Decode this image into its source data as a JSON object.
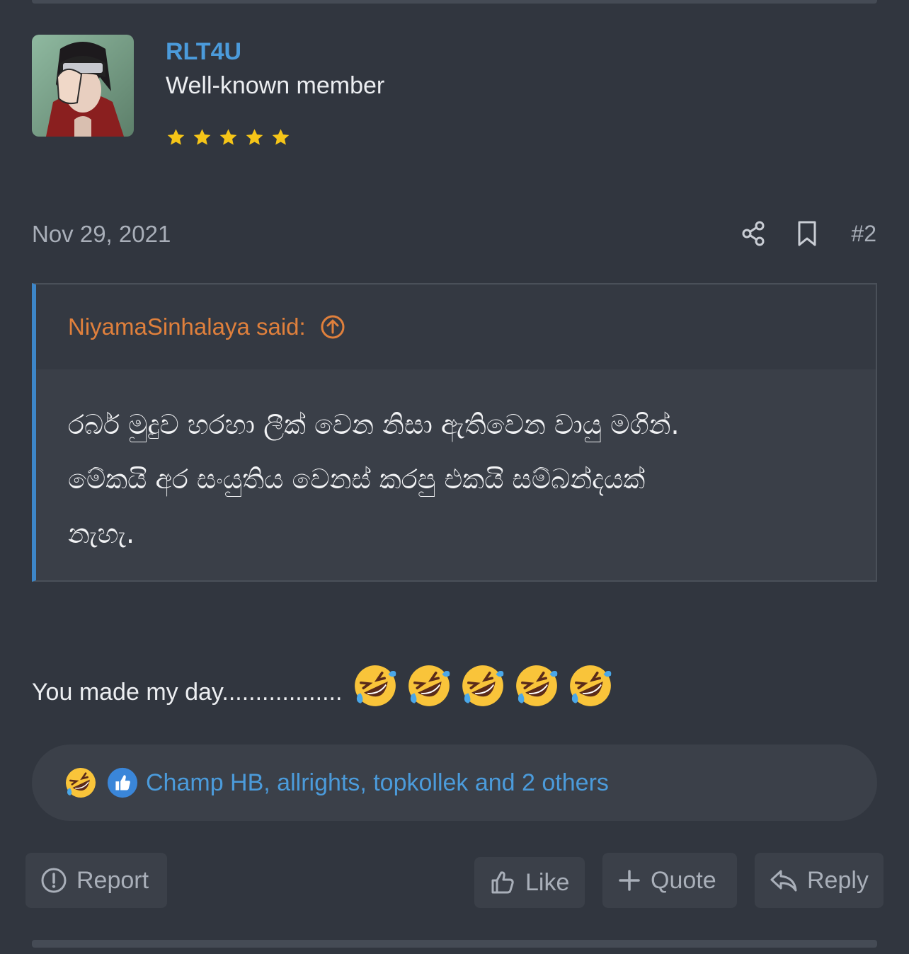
{
  "post": {
    "author": {
      "username": "RLT4U",
      "title": "Well-known member",
      "stars": 5
    },
    "date": "Nov 29, 2021",
    "number": "#2",
    "quote": {
      "author_label": "NiyamaSinhalaya said:",
      "lines": [
        "රබර් මුදුව හරහා ලීක් වෙන නිසා ඇතිවෙන වායු මගින්.",
        "මේකයි අර සංයුතිය වෙනස් කරපු එකයි සම්බන්දයක්",
        "නැහැ."
      ]
    },
    "message": "You made my day..................",
    "emoji_count": 5,
    "reactions": {
      "text": "Champ HB, allrights, topkollek and 2 others",
      "icons": [
        "laugh-reaction-icon",
        "like-reaction-icon"
      ]
    },
    "actions": {
      "report": "Report",
      "like": "Like",
      "quote": "Quote",
      "reply": "Reply"
    }
  },
  "colors": {
    "background": "#31363f",
    "link": "#4b9bdb",
    "quote_author": "#e0803c",
    "quote_border": "#3d86c8",
    "star": "#f5c518"
  }
}
